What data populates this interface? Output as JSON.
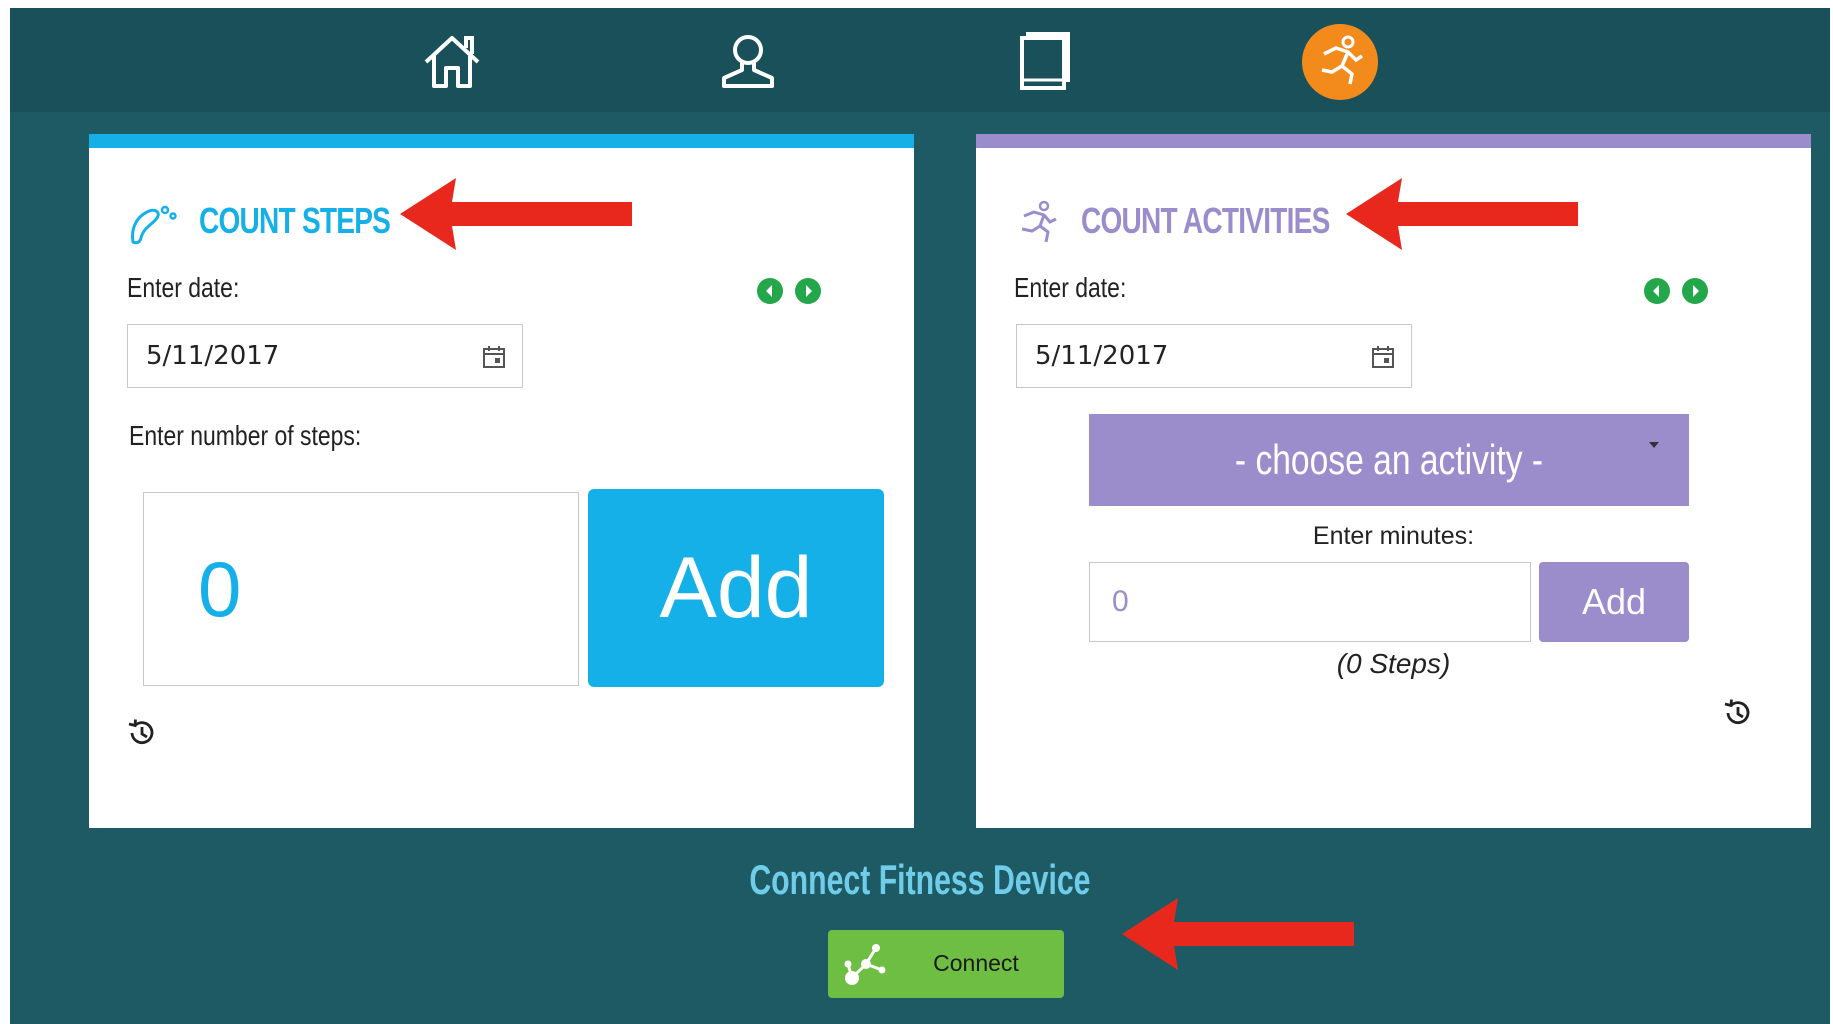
{
  "nav": {
    "items": [
      {
        "id": "home",
        "icon": "home-icon"
      },
      {
        "id": "profile",
        "icon": "user-icon"
      },
      {
        "id": "journal",
        "icon": "book-icon"
      },
      {
        "id": "activity",
        "icon": "runner-icon",
        "active": true
      }
    ]
  },
  "steps_card": {
    "title": "COUNT STEPS",
    "date_label": "Enter date:",
    "date_value": "5/11/2017",
    "steps_label": "Enter number of steps:",
    "steps_value": "0",
    "add_label": "Add"
  },
  "activities_card": {
    "title": "COUNT ACTIVITIES",
    "date_label": "Enter date:",
    "date_value": "5/11/2017",
    "select_value": "- choose an activity -",
    "minutes_label": "Enter minutes:",
    "minutes_value": "0",
    "add_label": "Add",
    "steps_note": "(0 Steps)"
  },
  "connect": {
    "title": "Connect Fitness Device",
    "button_label": "Connect"
  },
  "colors": {
    "background": "#1d5a64",
    "topbar": "#195059",
    "steps_accent": "#16b0e8",
    "activities_accent": "#9b8dcc",
    "active_nav": "#f28b1c",
    "connect_button": "#6fbe44",
    "nav_arrows": "#24a64a",
    "annotation_arrow": "#e8281c"
  }
}
